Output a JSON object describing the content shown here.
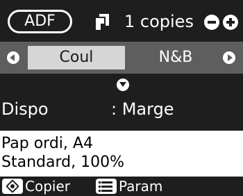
{
  "header": {
    "source_label": "ADF",
    "copies_text": "1 copies",
    "copies_icon": "copies-icon",
    "minus_icon": "minus-icon",
    "plus_icon": "plus-icon"
  },
  "mode_selector": {
    "options": [
      "Coul",
      "N&B"
    ],
    "selected": "Coul",
    "left_icon": "arrow-left-icon",
    "right_icon": "arrow-right-icon"
  },
  "scroll_icon": "arrow-down-icon",
  "setting": {
    "label": "Dispo",
    "value": ": Marge"
  },
  "info": {
    "line1": "Pap ordi, A4",
    "line2": "Standard, 100%"
  },
  "footer": {
    "start_icon": "start-diamond-icon",
    "start_label": "Copier",
    "menu_icon": "menu-icon",
    "menu_label": "Param"
  },
  "colors": {
    "background": "#1e1e1e",
    "selector_row": "#5e5e5e",
    "selected_option": "#d6d6d6",
    "info_panel": "#ffffff"
  }
}
